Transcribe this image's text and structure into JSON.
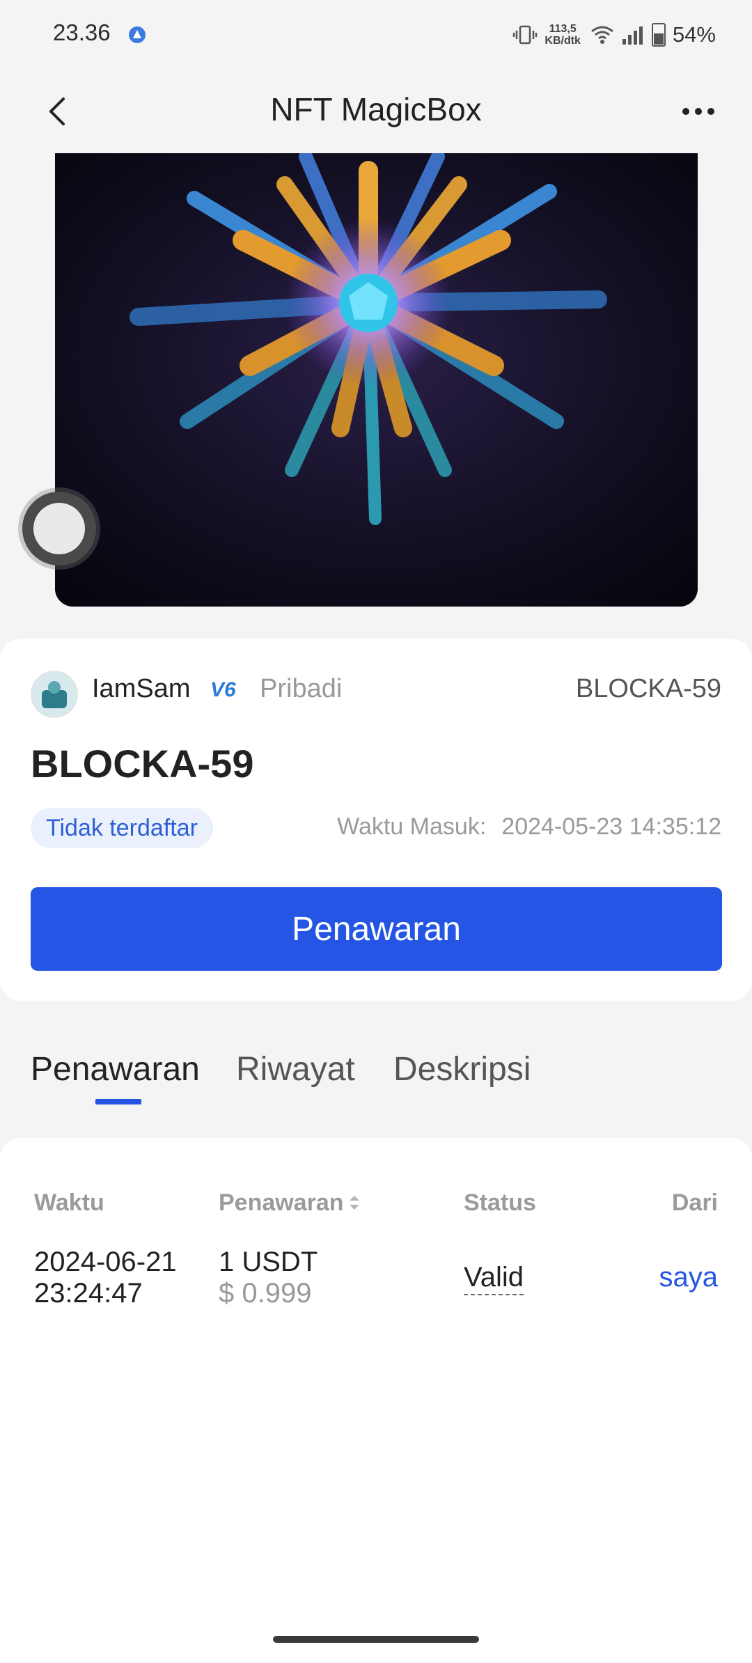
{
  "status_bar": {
    "time": "23.36",
    "net_speed_value": "113,5",
    "net_speed_unit": "KB/dtk",
    "battery": "54%",
    "battery_level": 0.54
  },
  "header": {
    "title": "NFT MagicBox"
  },
  "nft": {
    "owner_name": "IamSam",
    "owner_level": "V6",
    "owner_type": "Pribadi",
    "token_id": "BLOCKA-59",
    "title": "BLOCKA-59",
    "listing_status": "Tidak terdaftar",
    "entry_time_label": "Waktu Masuk:",
    "entry_time_value": "2024-05-23 14:35:12",
    "offer_button": "Penawaran"
  },
  "tabs": [
    {
      "label": "Penawaran",
      "active": true
    },
    {
      "label": "Riwayat",
      "active": false
    },
    {
      "label": "Deskripsi",
      "active": false
    }
  ],
  "offers_table": {
    "columns": [
      "Waktu",
      "Penawaran",
      "Status",
      "Dari"
    ],
    "rows": [
      {
        "time_date": "2024-06-21",
        "time_clock": "23:24:47",
        "amount": "1 USDT",
        "amount_usd": "$ 0.999",
        "status": "Valid",
        "from": "saya"
      }
    ]
  },
  "colors": {
    "primary": "#2455e4",
    "background": "#f4f4f5",
    "badge_bg": "#eaf1fd"
  }
}
